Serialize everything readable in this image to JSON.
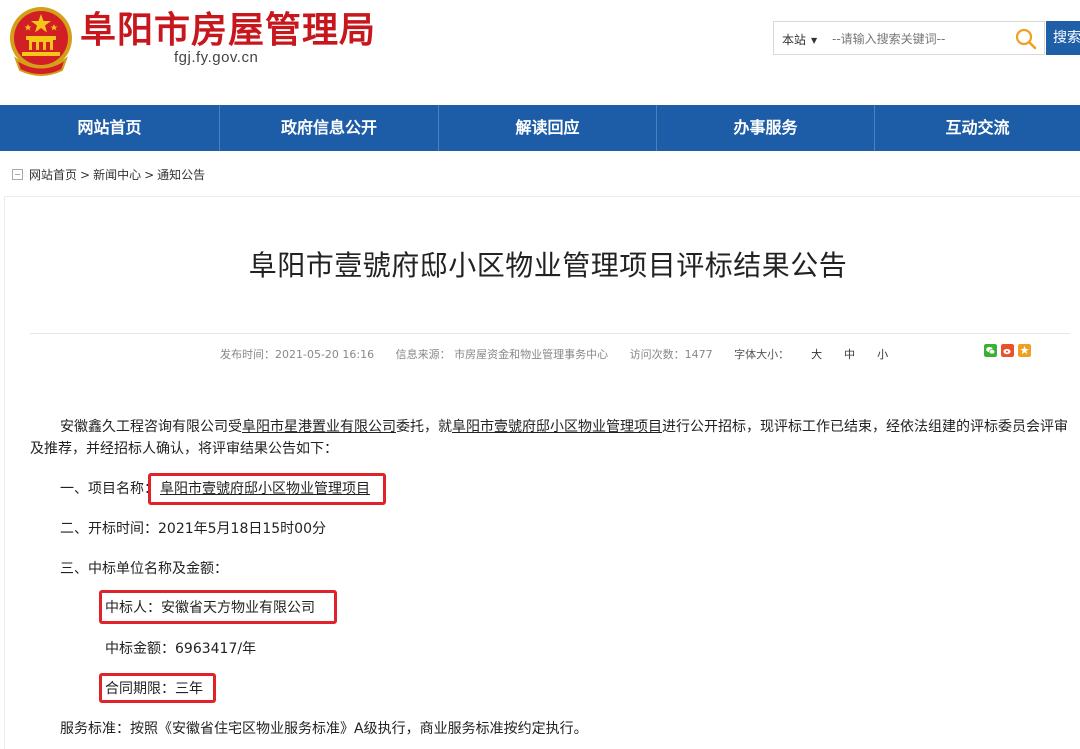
{
  "header": {
    "site_title": "阜阳市房屋管理局",
    "site_domain": "fgj.fy.gov.cn",
    "search": {
      "scope": "本站",
      "placeholder": "--请输入搜索关键词--",
      "button": "搜索"
    }
  },
  "nav": {
    "items": [
      "网站首页",
      "政府信息公开",
      "解读回应",
      "办事服务",
      "互动交流"
    ]
  },
  "breadcrumb": [
    "网站首页",
    "新闻中心",
    "通知公告"
  ],
  "article": {
    "title": "阜阳市壹號府邸小区物业管理项目评标结果公告",
    "meta": {
      "publish_time": "发布时间：2021-05-20 16:16",
      "source": "信息来源：  市房屋资金和物业管理事务中心",
      "visits": "访问次数：1477",
      "font_size_label": "字体大小：",
      "font_sizes": [
        "大",
        "中",
        "小"
      ]
    },
    "intro": {
      "p1": "安徽鑫久工程咨询有限公司受",
      "entity": "阜阳市星港置业有限公司",
      "p2": "委托，就",
      "project": "阜阳市壹號府邸小区物业管理项目",
      "p3": "进行公开招标，现评标工作已结束，经依法组建的评标委员会评审及推荐，并经招标人确认，将评审结果公告如下："
    },
    "item1_label": "一、项目名称：",
    "item1_value": "阜阳市壹號府邸小区物业管理项目",
    "item2": "二、开标时间：2021年5月18日15时00分",
    "item3": "三、中标单位名称及金额：",
    "winner": "中标人：安徽省天方物业有限公司",
    "amount": "中标金额：6963417/年",
    "contract": "合同期限：三年",
    "service": "服务标准：按照《安徽省住宅区物业服务标准》A级执行，商业服务标准按约定执行。"
  },
  "colors": {
    "brand_red": "#c8161d",
    "nav_blue": "#1d5da8",
    "highlight_red": "#e0222a"
  },
  "icons": [
    "national-emblem-icon",
    "search-icon",
    "breadcrumb-icon",
    "wechat-icon",
    "weibo-icon",
    "favorite-icon"
  ]
}
